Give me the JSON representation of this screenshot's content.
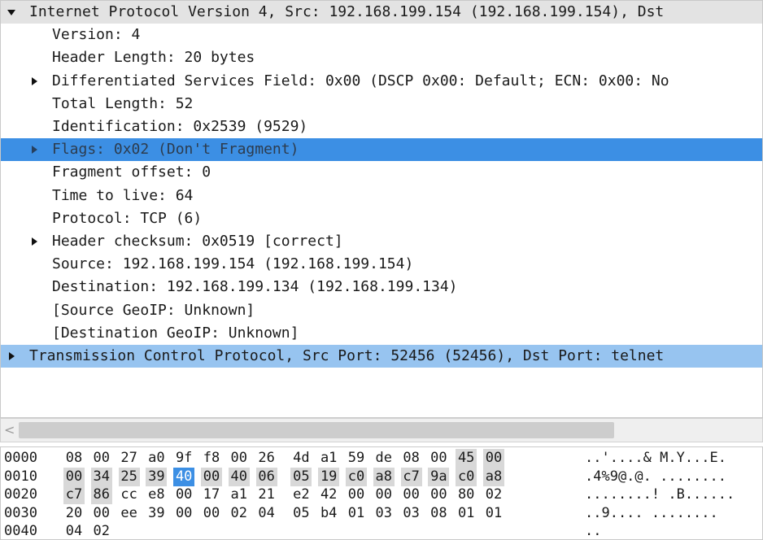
{
  "details_tree": {
    "rows": [
      {
        "text": "Internet Protocol Version 4, Src: 192.168.199.154 (192.168.199.154), Dst",
        "level": 0,
        "expander": "down",
        "style": "section"
      },
      {
        "text": "Version: 4",
        "level": 1,
        "expander": "none",
        "style": "normal"
      },
      {
        "text": "Header Length: 20 bytes",
        "level": 1,
        "expander": "none",
        "style": "normal"
      },
      {
        "text": "Differentiated Services Field: 0x00 (DSCP 0x00: Default; ECN: 0x00: No",
        "level": 1,
        "expander": "right",
        "style": "normal"
      },
      {
        "text": "Total Length: 52",
        "level": 1,
        "expander": "none",
        "style": "normal"
      },
      {
        "text": "Identification: 0x2539 (9529)",
        "level": 1,
        "expander": "none",
        "style": "normal"
      },
      {
        "text": "Flags: 0x02 (Don't Fragment)",
        "level": 1,
        "expander": "right",
        "style": "selected"
      },
      {
        "text": "Fragment offset: 0",
        "level": 1,
        "expander": "none",
        "style": "normal"
      },
      {
        "text": "Time to live: 64",
        "level": 1,
        "expander": "none",
        "style": "normal"
      },
      {
        "text": "Protocol: TCP (6)",
        "level": 1,
        "expander": "none",
        "style": "normal"
      },
      {
        "text": "Header checksum: 0x0519 [correct]",
        "level": 1,
        "expander": "right",
        "style": "normal"
      },
      {
        "text": "Source: 192.168.199.154 (192.168.199.154)",
        "level": 1,
        "expander": "none",
        "style": "normal"
      },
      {
        "text": "Destination: 192.168.199.134 (192.168.199.134)",
        "level": 1,
        "expander": "none",
        "style": "normal"
      },
      {
        "text": "[Source GeoIP: Unknown]",
        "level": 1,
        "expander": "none",
        "style": "normal"
      },
      {
        "text": "[Destination GeoIP: Unknown]",
        "level": 1,
        "expander": "none",
        "style": "normal"
      },
      {
        "text": "Transmission Control Protocol, Src Port: 52456 (52456), Dst Port: telnet",
        "level": 0,
        "expander": "right",
        "style": "proto"
      }
    ]
  },
  "hscroll": {
    "left_arrow": "<"
  },
  "hex_dump": {
    "rows": [
      {
        "offset": "0000",
        "bytes": [
          "08",
          "00",
          "27",
          "a0",
          "9f",
          "f8",
          "00",
          "26",
          "4d",
          "a1",
          "59",
          "de",
          "08",
          "00",
          "45",
          "00"
        ],
        "ascii": "..'....& M.Y...E."
      },
      {
        "offset": "0010",
        "bytes": [
          "00",
          "34",
          "25",
          "39",
          "40",
          "00",
          "40",
          "06",
          "05",
          "19",
          "c0",
          "a8",
          "c7",
          "9a",
          "c0",
          "a8"
        ],
        "ascii": ".4%9@.@. ........"
      },
      {
        "offset": "0020",
        "bytes": [
          "c7",
          "86",
          "cc",
          "e8",
          "00",
          "17",
          "a1",
          "21",
          "e2",
          "42",
          "00",
          "00",
          "00",
          "00",
          "80",
          "02"
        ],
        "ascii": "........! .B......"
      },
      {
        "offset": "0030",
        "bytes": [
          "20",
          "00",
          "ee",
          "39",
          "00",
          "00",
          "02",
          "04",
          "05",
          "b4",
          "01",
          "03",
          "03",
          "08",
          "01",
          "01"
        ],
        "ascii": " ..9.... ........"
      },
      {
        "offset": "0040",
        "bytes": [
          "04",
          "02"
        ],
        "ascii": ".."
      }
    ],
    "highlight_start": 14,
    "highlight_end": 33,
    "selected_byte": 20
  }
}
